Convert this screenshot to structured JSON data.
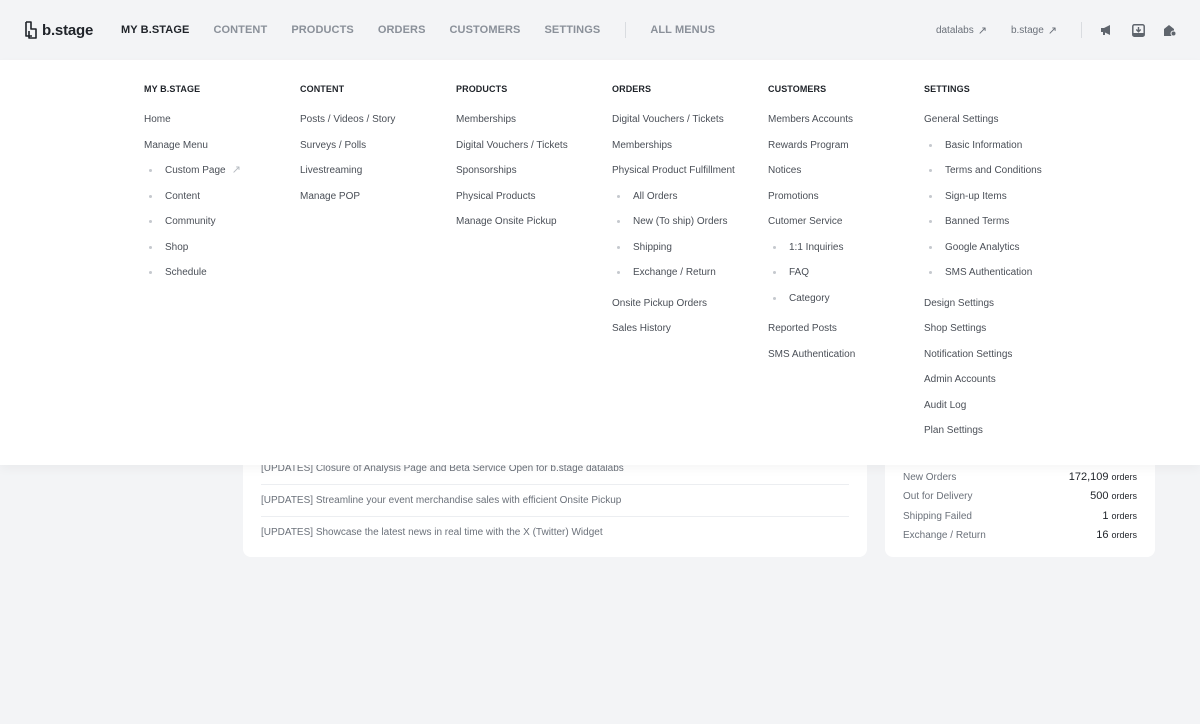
{
  "brand": {
    "name": "b.stage"
  },
  "nav": {
    "items": [
      "MY B.STAGE",
      "CONTENT",
      "PRODUCTS",
      "ORDERS",
      "CUSTOMERS",
      "SETTINGS"
    ],
    "all_menus": "ALL MENUS",
    "active": "MY B.STAGE"
  },
  "right_nav": {
    "datalabs": "datalabs",
    "bstage": "b.stage",
    "icons": [
      "megaphone-icon",
      "inbox-icon",
      "store-settings-icon"
    ]
  },
  "menu": {
    "my_bstage": {
      "title": "MY B.STAGE",
      "items": [
        "Home",
        "Manage Menu",
        "Custom Page",
        "Content",
        "Community",
        "Shop",
        "Schedule"
      ]
    },
    "content": {
      "title": "CONTENT",
      "items": [
        "Posts / Videos / Story",
        "Surveys / Polls",
        "Livestreaming",
        "Manage POP"
      ]
    },
    "products": {
      "title": "PRODUCTS",
      "items": [
        "Memberships",
        "Digital Vouchers / Tickets",
        "Sponsorships",
        "Physical Products",
        "Manage Onsite Pickup"
      ]
    },
    "orders": {
      "title": "ORDERS",
      "items": [
        "Digital Vouchers / Tickets",
        "Memberships",
        "Physical Product Fulfillment",
        "All Orders",
        "New (To ship) Orders",
        "Shipping",
        "Exchange / Return",
        "Onsite Pickup Orders",
        "Sales History"
      ]
    },
    "customers": {
      "title": "CUSTOMERS",
      "items": [
        "Members Accounts",
        "Rewards Program",
        "Notices",
        "Promotions",
        "Cutomer Service",
        "1:1 Inquiries",
        "FAQ",
        "Category",
        "Reported Posts",
        "SMS Authentication"
      ]
    },
    "settings": {
      "title": "SETTINGS",
      "items": [
        "General Settings",
        "Basic Information",
        "Terms and Conditions",
        "Sign-up Items",
        "Banned Terms",
        "Google Analytics",
        "SMS Authentication",
        "Design Settings",
        "Shop Settings",
        "Notification Settings",
        "Admin Accounts",
        "Audit Log",
        "Plan Settings"
      ]
    }
  },
  "news": [
    "[UPDATES] Closure of Analysis Page and Beta Service Open for b.stage datalabs",
    "[UPDATES] Streamline your event merchandise sales with efficient Onsite Pickup",
    "[UPDATES] Showcase the latest news in real time with the X (Twitter) Widget"
  ],
  "orders_summary": {
    "unit": "orders",
    "rows": [
      {
        "label": "New Orders",
        "value": "172,109"
      },
      {
        "label": "Out for Delivery",
        "value": "500"
      },
      {
        "label": "Shipping Failed",
        "value": "1"
      },
      {
        "label": "Exchange / Return",
        "value": "16"
      }
    ]
  }
}
